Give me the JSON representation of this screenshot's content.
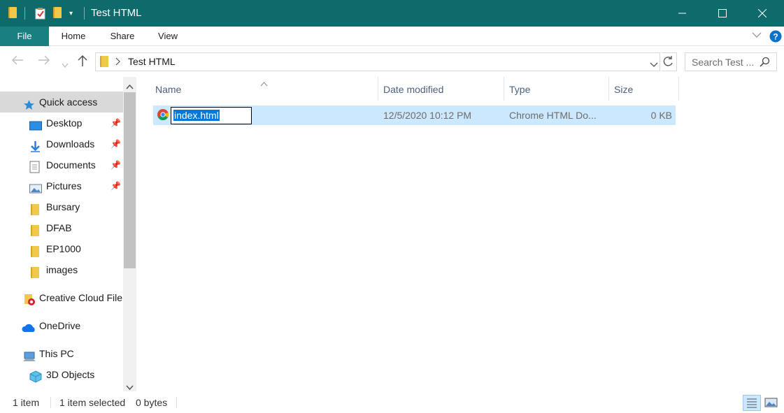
{
  "window": {
    "title": "Test HTML"
  },
  "ribbon": {
    "tabs": [
      "File",
      "Home",
      "Share",
      "View"
    ]
  },
  "address": {
    "path": "Test HTML",
    "search_placeholder": "Search Test ..."
  },
  "nav": {
    "quick_access": "Quick access",
    "items": [
      "Desktop",
      "Downloads",
      "Documents",
      "Pictures",
      "Bursary",
      "DFAB",
      "EP1000",
      "images"
    ],
    "creative_cloud": "Creative Cloud File",
    "onedrive": "OneDrive",
    "this_pc": "This PC",
    "objects_3d": "3D Objects"
  },
  "columns": {
    "name": "Name",
    "date": "Date modified",
    "type": "Type",
    "size": "Size"
  },
  "files": [
    {
      "name": "index.html",
      "date": "12/5/2020 10:12 PM",
      "type": "Chrome HTML Do...",
      "size": "0 KB"
    }
  ],
  "status": {
    "count": "1 item",
    "selected": "1 item selected",
    "bytes": "0 bytes"
  },
  "colors": {
    "titlebar": "#0f6b6b",
    "file_tab": "#1a7f7f",
    "selection": "#cce8ff",
    "rename_highlight": "#0078d7"
  }
}
